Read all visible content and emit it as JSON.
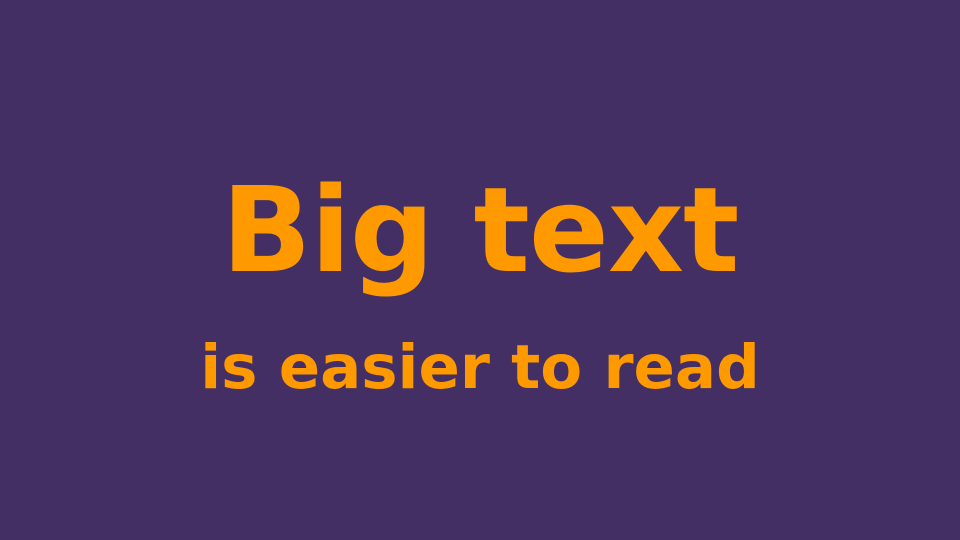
{
  "slide": {
    "headline": "Big text",
    "subline": "is easier to read",
    "colors": {
      "background": "#432F63",
      "text": "#FF9900"
    }
  }
}
